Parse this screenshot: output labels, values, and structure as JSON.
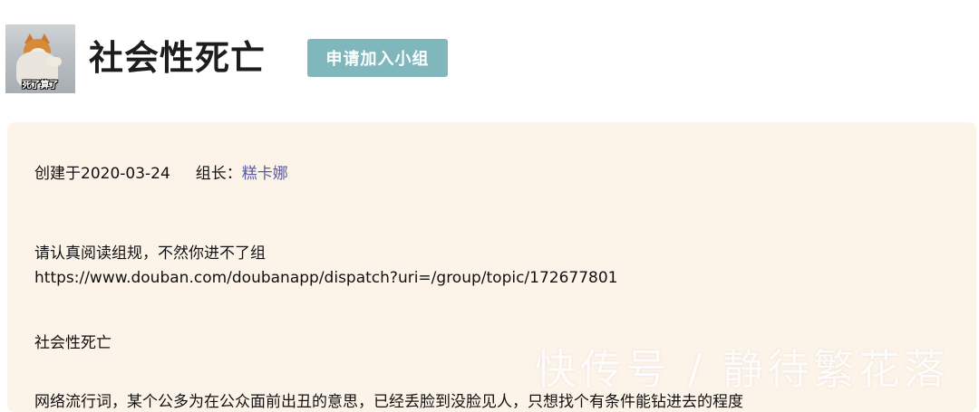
{
  "group": {
    "avatar_caption": "死了算了",
    "title": "社会性死亡",
    "join_label": "申请加入小组"
  },
  "info": {
    "created": "创建于2020-03-24",
    "leader_label": "组长：",
    "leader_name": "糕卡娜",
    "rules_line1": "请认真阅读组规，不然你进不了组",
    "rules_line2": "https://www.douban.com/doubanapp/dispatch?uri=/group/topic/172677801",
    "name_line": "社会性死亡",
    "cut_line": "网络流行词，某个公多为在公众面前出丑的意思，已经丢脸到没脸见人，只想找个有条件能钻进去的程度"
  },
  "watermark": "快传号 / 静待繁花落"
}
